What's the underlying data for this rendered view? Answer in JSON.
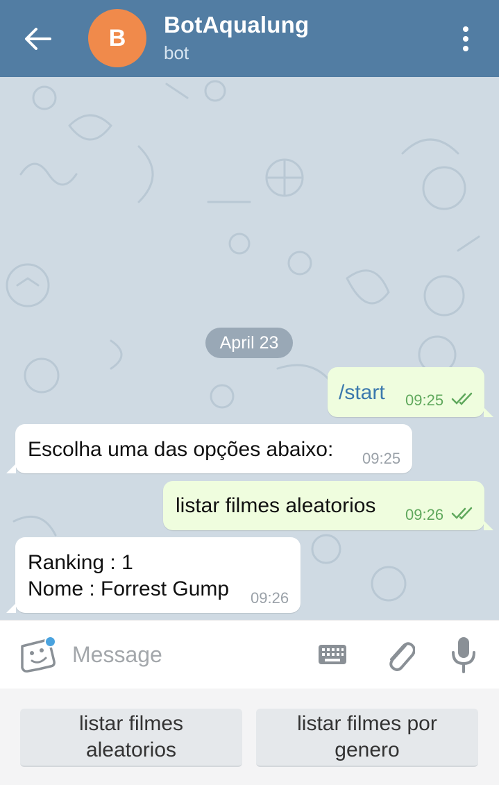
{
  "header": {
    "avatar_letter": "B",
    "title": "BotAqualung",
    "subtitle": "bot",
    "bg_color": "#527da3",
    "avatar_color": "#f08a4b"
  },
  "chat": {
    "date_label": "April 23",
    "messages": [
      {
        "direction": "out",
        "text": "/start",
        "time": "09:25",
        "status": "read"
      },
      {
        "direction": "in",
        "text": "Escolha uma das opções abaixo:",
        "time": "09:25"
      },
      {
        "direction": "out",
        "text": "listar filmes aleatorios",
        "time": "09:26",
        "status": "read"
      },
      {
        "direction": "in",
        "lines": [
          "Ranking : 1",
          "Nome : Forrest Gump"
        ],
        "time": "09:26"
      }
    ]
  },
  "composer": {
    "placeholder": "Message",
    "icons": [
      "sticker-icon",
      "keyboard-icon",
      "attach-icon",
      "mic-icon"
    ]
  },
  "reply_keyboard": {
    "buttons": [
      {
        "lines": [
          "listar filmes",
          "aleatorios"
        ]
      },
      {
        "lines": [
          "listar filmes por",
          "genero"
        ]
      }
    ]
  }
}
